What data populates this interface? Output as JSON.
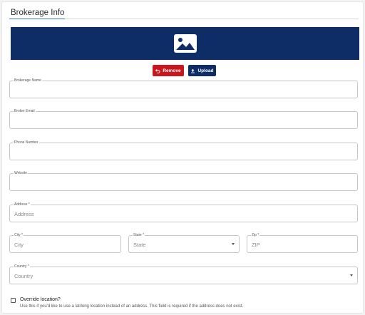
{
  "header": {
    "title": "Brokerage Info"
  },
  "banner": {
    "icon": "image-placeholder-icon",
    "color": "#0e2c66"
  },
  "actions": {
    "remove_label": "Remove",
    "upload_label": "Upload",
    "remove_color": "#c8171e",
    "upload_color": "#0e2c66"
  },
  "fields": {
    "brokerage_name": {
      "label": "Brokerage Name",
      "value": ""
    },
    "broker_email": {
      "label": "Broker Email",
      "value": ""
    },
    "phone_number": {
      "label": "Phone Number",
      "value": ""
    },
    "website": {
      "label": "Website",
      "value": ""
    },
    "address": {
      "label": "Address *",
      "placeholder": "Address"
    },
    "city": {
      "label": "City *",
      "placeholder": "City"
    },
    "state": {
      "label": "State *",
      "placeholder": "State"
    },
    "zip": {
      "label": "Zip *",
      "placeholder": "ZIP"
    },
    "country": {
      "label": "Country *",
      "placeholder": "Country"
    }
  },
  "override": {
    "label": "Override location?",
    "help": "Use this if you'd like to use a lat/long location instead of an address. This field is required if the address does not exist.",
    "checked": false
  },
  "colors": {
    "accent": "#2e6fd8"
  }
}
